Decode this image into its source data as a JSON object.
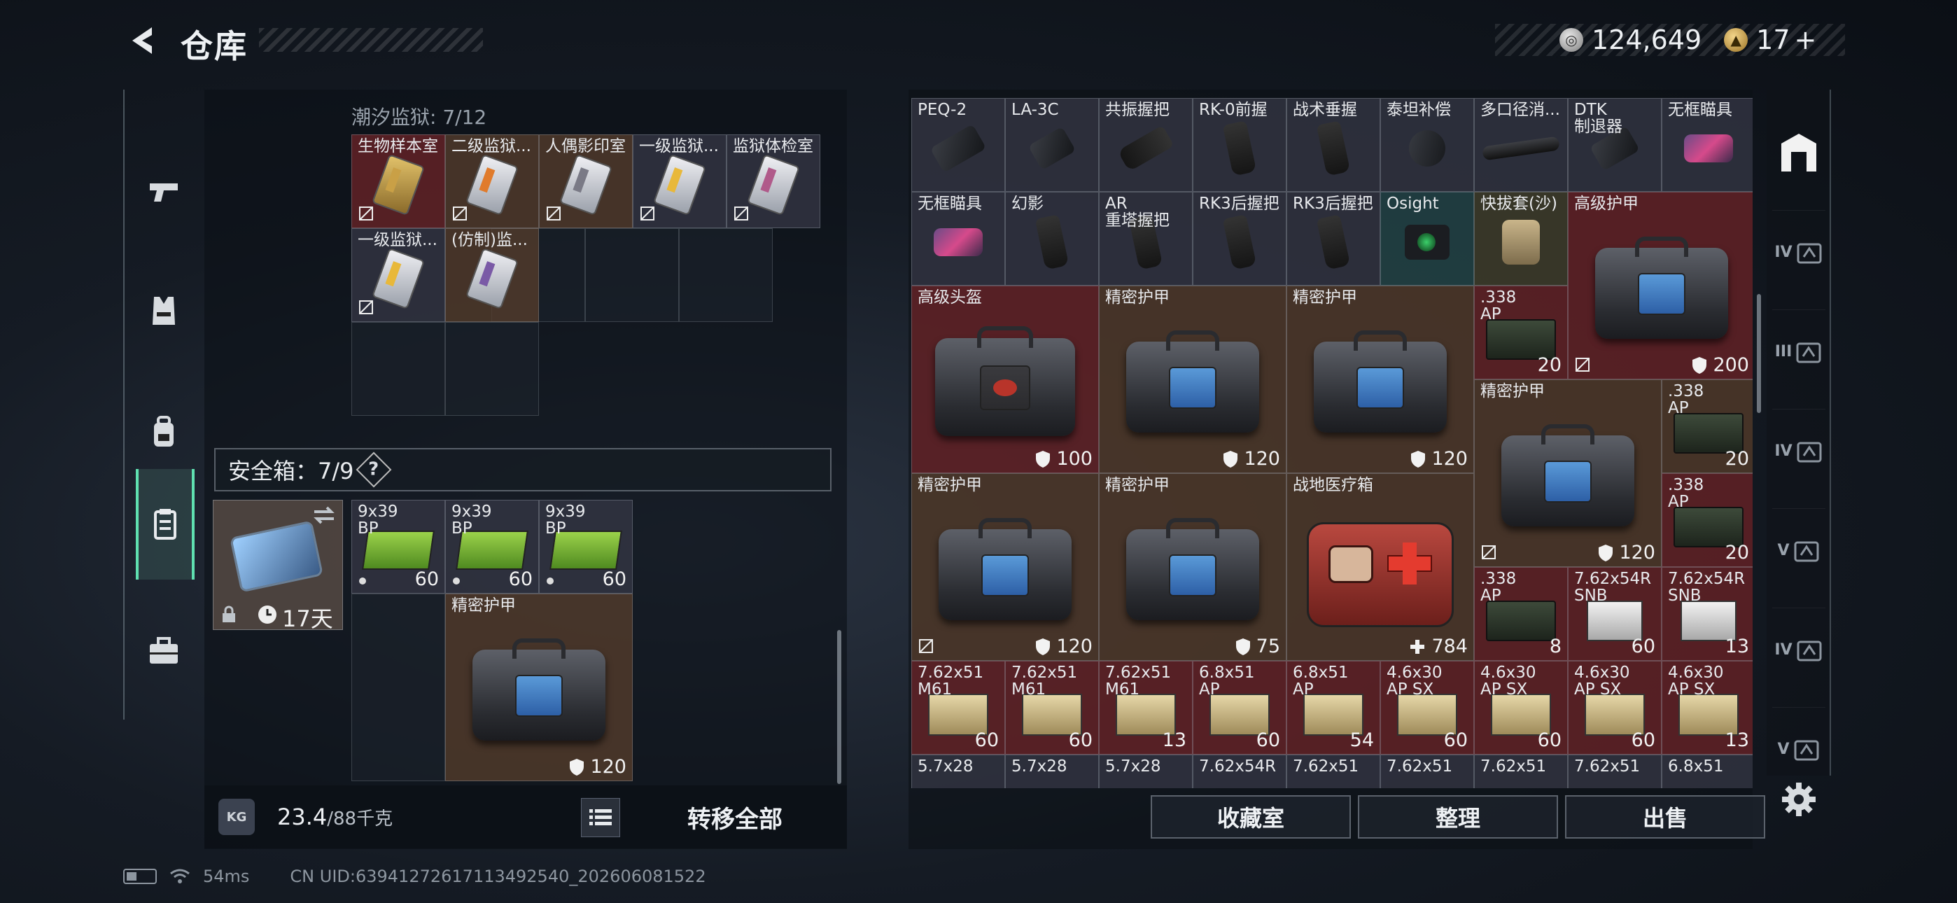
{
  "header": {
    "title": "仓库",
    "currency_silver": "124,649",
    "currency_gold": "17",
    "currency_gold_plus": "+"
  },
  "left_nav": {
    "items": [
      {
        "name": "weapons",
        "icon": "pistol-icon"
      },
      {
        "name": "vest",
        "icon": "vest-icon"
      },
      {
        "name": "backpack",
        "icon": "backpack-icon"
      },
      {
        "name": "container",
        "icon": "clipboard-icon",
        "active": true
      },
      {
        "name": "toolbox",
        "icon": "toolbox-icon"
      }
    ]
  },
  "keycase": {
    "title": "潮汐监狱: 7/12",
    "items": [
      {
        "name": "生物样本室"
      },
      {
        "name": "二级监狱..."
      },
      {
        "name": "人偶影印室"
      },
      {
        "name": "一级监狱..."
      },
      {
        "name": "监狱体检室"
      },
      {
        "name": "一级监狱..."
      },
      {
        "name": "(仿制)监..."
      }
    ]
  },
  "safebox": {
    "title": "安全箱：7/9",
    "help": "?",
    "duration": "17天",
    "ammo": [
      {
        "name": "9x39\nBP",
        "count": "60"
      },
      {
        "name": "9x39\nBP",
        "count": "60"
      },
      {
        "name": "9x39\nBP",
        "count": "60"
      }
    ],
    "armor": {
      "name": "精密护甲",
      "value": "120"
    }
  },
  "weight": {
    "current": "23.4",
    "max": "/88千克",
    "icon_text": "KG"
  },
  "actions": {
    "transfer_all": "转移全部",
    "collection": "收藏室",
    "sort": "整理",
    "sell": "出售"
  },
  "stash": {
    "row1": [
      "PEQ-2",
      "LA-3C",
      "共振握把",
      "RK-0前握",
      "战术垂握",
      "泰坦补偿",
      "多口径消...",
      "DTK\n制退器",
      "无框瞄具"
    ],
    "row2": [
      "无框瞄具",
      "幻影",
      "AR\n重塔握把",
      "RK3后握把",
      "RK3后握把",
      "Osight",
      "快拔套(沙)"
    ],
    "big_armor_top": {
      "name": "高级护甲",
      "value": "200"
    },
    "helmet": {
      "name": "高级头盔",
      "value": "100"
    },
    "armor_a": {
      "name": "精密护甲",
      "value": "120"
    },
    "armor_b": {
      "name": "精密护甲",
      "value": "120"
    },
    "armor_c": {
      "name": "精密护甲",
      "value": "120"
    },
    "armor_d": {
      "name": "精密护甲",
      "value": "120"
    },
    "armor_e": {
      "name": "精密护甲",
      "value": "75"
    },
    "ap_cans": [
      {
        "name": ".338\nAP",
        "count": "20"
      },
      {
        "name": ".338\nAP",
        "count": "20"
      },
      {
        "name": ".338\nAP",
        "count": "20"
      },
      {
        "name": ".338\nAP",
        "count": "8"
      }
    ],
    "medkit": {
      "name": "战地医疗箱",
      "value": "784"
    },
    "snb": [
      {
        "name": "7.62x54R\nSNB",
        "count": "60"
      },
      {
        "name": "7.62x54R\nSNB",
        "count": "13"
      }
    ],
    "row_ammo": [
      {
        "name": "7.62x51\nM61",
        "count": "60"
      },
      {
        "name": "7.62x51\nM61",
        "count": "60"
      },
      {
        "name": "7.62x51\nM61",
        "count": "13"
      },
      {
        "name": "6.8x51\nAP",
        "count": "60"
      },
      {
        "name": "6.8x51\nAP",
        "count": "54"
      },
      {
        "name": "4.6x30\nAP SX",
        "count": "60"
      },
      {
        "name": "4.6x30\nAP SX",
        "count": "60"
      },
      {
        "name": "4.6x30\nAP SX",
        "count": "60"
      },
      {
        "name": "4.6x30\nAP SX",
        "count": "13"
      }
    ],
    "row_partial": [
      "5.7x28",
      "5.7x28",
      "5.7x28",
      "7.62x54R",
      "7.62x51",
      "7.62x51",
      "7.62x51",
      "7.62x51",
      "6.8x51"
    ]
  },
  "right_nav": {
    "items": [
      "IV",
      "III",
      "IV",
      "V",
      "IV",
      "V"
    ]
  },
  "status": {
    "ping": "54ms",
    "uid": "CN UID:6394127261711349254​0_202606081522"
  },
  "colors": {
    "accent": "#5fe0b0",
    "red_tile": "#6e2428",
    "brown_tile": "#543c2c"
  }
}
